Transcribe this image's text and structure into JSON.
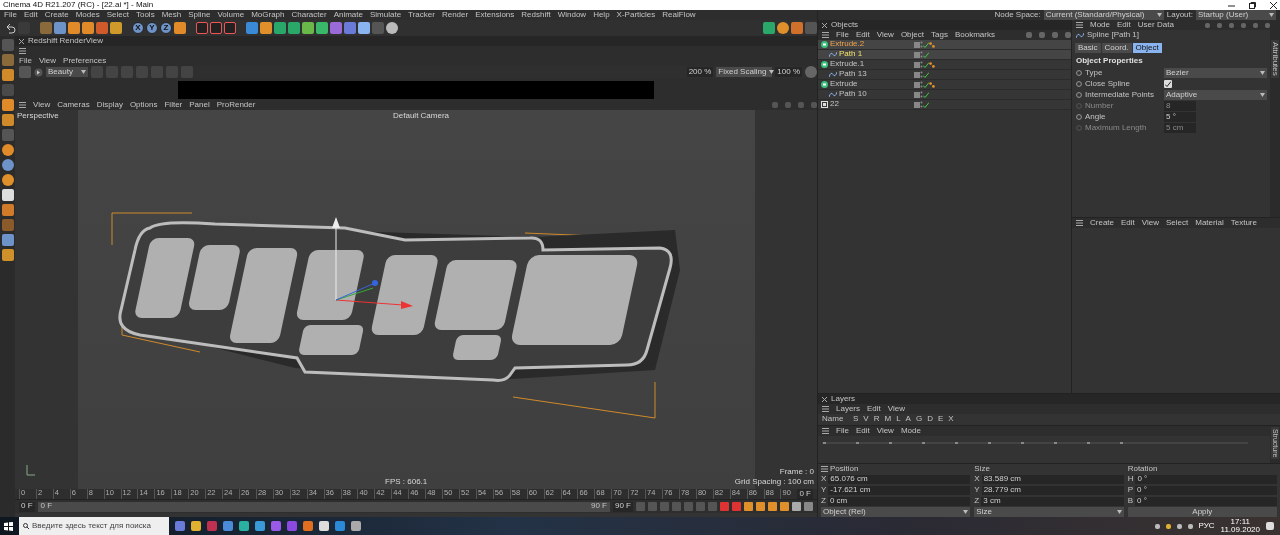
{
  "window": {
    "title": "Cinema 4D R21.207 (RC) - [22.ai *] - Main"
  },
  "menu_bar": [
    "File",
    "Edit",
    "Create",
    "Modes",
    "Select",
    "Tools",
    "Mesh",
    "Spline",
    "Volume",
    "MoGraph",
    "Character",
    "Animate",
    "Simulate",
    "Tracker",
    "Render",
    "Extensions",
    "Redshift",
    "Window",
    "Help",
    "X-Particles",
    "RealFlow"
  ],
  "axis_buttons": [
    {
      "label": "X",
      "selected": true
    },
    {
      "label": "Y",
      "selected": true
    },
    {
      "label": "Z",
      "selected": true
    }
  ],
  "node_space": {
    "label": "Node Space:",
    "value": "Current (Standard/Physical)"
  },
  "layout": {
    "label": "Layout:",
    "value": "Startup (User)"
  },
  "render_view": {
    "title": "Redshift RenderView",
    "menu": [
      "File",
      "View",
      "Preferences"
    ],
    "aov": "Beauty",
    "zoom": "200 %",
    "scaling": "Fixed Scaling",
    "zoom_out": "100 %"
  },
  "viewport": {
    "menu": [
      "View",
      "Cameras",
      "Display",
      "Options",
      "Filter",
      "Panel",
      "ProRender"
    ],
    "projection": "Perspective",
    "camera": "Default Camera",
    "fps": "FPS : 606.1",
    "frame": "Frame : 0",
    "grid_spacing": "Grid Spacing : 100 cm"
  },
  "timeline": {
    "ticks": [
      "0",
      "2",
      "4",
      "6",
      "8",
      "10",
      "12",
      "14",
      "16",
      "18",
      "20",
      "22",
      "24",
      "26",
      "28",
      "30",
      "32",
      "34",
      "36",
      "38",
      "40",
      "42",
      "44",
      "46",
      "48",
      "50",
      "52",
      "54",
      "56",
      "58",
      "60",
      "62",
      "64",
      "66",
      "68",
      "70",
      "72",
      "74",
      "76",
      "78",
      "80",
      "82",
      "84",
      "86",
      "88",
      "90"
    ],
    "ruler_end": "0 F",
    "start": "0 F",
    "range": {
      "start": "0 F",
      "end": "90 F",
      "level": 1
    },
    "end": "90 F"
  },
  "objects": {
    "title": "Objects",
    "menu": [
      "File",
      "Edit",
      "View",
      "Object",
      "Tags",
      "Bookmarks"
    ],
    "tree": [
      {
        "name": "Extrude.2",
        "kind": "extrude",
        "selected": true,
        "active": false,
        "children": [
          {
            "name": "Path 1",
            "kind": "spline",
            "selected": true,
            "active": true
          }
        ]
      },
      {
        "name": "Extrude.1",
        "kind": "extrude",
        "selected": false,
        "active": false,
        "children": [
          {
            "name": "Path 13",
            "kind": "spline",
            "selected": false,
            "active": false
          }
        ]
      },
      {
        "name": "Extrude",
        "kind": "extrude",
        "selected": false,
        "active": false,
        "children": [
          {
            "name": "Path 10",
            "kind": "spline",
            "selected": false,
            "active": false
          }
        ]
      },
      {
        "name": "22",
        "kind": "group",
        "selected": false,
        "active": false
      }
    ]
  },
  "attributes": {
    "menu": [
      "Mode",
      "Edit",
      "User Data"
    ],
    "object": "Spline [Path 1]",
    "tabs": [
      {
        "label": "Basic",
        "selected": false
      },
      {
        "label": "Coord.",
        "selected": false
      },
      {
        "label": "Object",
        "selected": true
      }
    ],
    "section": "Object Properties",
    "fields": [
      {
        "label": "Type",
        "kind": "select",
        "value": "Bezier",
        "disabled": false
      },
      {
        "label": "Close Spline",
        "kind": "checkbox",
        "checked": true,
        "disabled": false
      },
      {
        "label": "Intermediate Points",
        "kind": "select",
        "value": "Adaptive",
        "disabled": false
      },
      {
        "label": "Number",
        "kind": "number",
        "value": "8",
        "disabled": true
      },
      {
        "label": "Angle",
        "kind": "number",
        "value": "5 °",
        "disabled": false
      },
      {
        "label": "Maximum Length",
        "kind": "number",
        "value": "5 cm",
        "disabled": true
      }
    ],
    "side_tab": "Attributes"
  },
  "materials": {
    "menu": [
      "Create",
      "Edit",
      "View",
      "Select",
      "Material",
      "Texture"
    ]
  },
  "layers": {
    "title": "Layers",
    "menu": [
      "Layers",
      "Edit",
      "View"
    ],
    "name_label": "Name",
    "columns": [
      "S",
      "V",
      "R",
      "M",
      "L",
      "A",
      "G",
      "D",
      "E",
      "X"
    ]
  },
  "structure": {
    "menu": [
      "File",
      "Edit",
      "View",
      "Mode"
    ],
    "side_tab": "Structure"
  },
  "coordinates": {
    "headers": [
      "Position",
      "Size",
      "Rotation"
    ],
    "rows": [
      [
        {
          "axis": "X",
          "value": "65.076 cm"
        },
        {
          "axis": "X",
          "value": "83.589 cm"
        },
        {
          "axis": "H",
          "value": "0 °"
        }
      ],
      [
        {
          "axis": "Y",
          "value": "-17.621 cm"
        },
        {
          "axis": "Y",
          "value": "28.779 cm"
        },
        {
          "axis": "P",
          "value": "0 °"
        }
      ],
      [
        {
          "axis": "Z",
          "value": "0 cm"
        },
        {
          "axis": "Z",
          "value": "3 cm"
        },
        {
          "axis": "B",
          "value": "0 °"
        }
      ]
    ],
    "mode": "Object (Rel)",
    "size_mode": "Size",
    "apply": "Apply"
  },
  "taskbar": {
    "search_placeholder": "Введите здесь текст для поиска",
    "language": "РУС",
    "time": "17:11",
    "date": "11.09.2020"
  }
}
